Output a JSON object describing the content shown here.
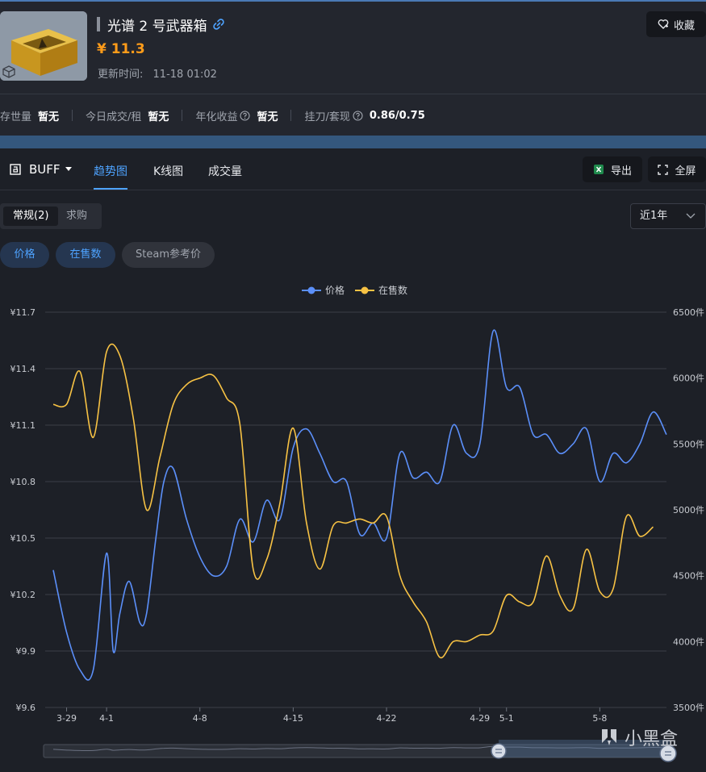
{
  "item": {
    "title": "光谱 2 号武器箱",
    "price": "¥ 11.3",
    "update_label": "更新时间:",
    "update_time": "11-18 01:02",
    "favorite_label": "收藏"
  },
  "stats": [
    {
      "label": "存世量",
      "value": "暂无",
      "help": false
    },
    {
      "label": "今日成交/租",
      "value": "暂无",
      "help": false
    },
    {
      "label": "年化收益",
      "value": "暂无",
      "help": true
    },
    {
      "label": "挂刀/套现",
      "value": "0.86/0.75",
      "help": true
    }
  ],
  "toolbar": {
    "source": "BUFF",
    "tabs": [
      "趋势图",
      "K线图",
      "成交量"
    ],
    "active_tab": 0,
    "export_label": "导出",
    "fullscreen_label": "全屏"
  },
  "filters": {
    "options": [
      "常规(2)",
      "求购"
    ],
    "active": 0,
    "range": "近1年"
  },
  "series_toggles": [
    {
      "label": "价格",
      "on": true
    },
    {
      "label": "在售数",
      "on": true
    },
    {
      "label": "Steam参考价",
      "on": false
    }
  ],
  "watermark": "小黑盒",
  "chart_data": {
    "type": "line",
    "legend_position": "top-center",
    "grid": true,
    "x_ticks": [
      "3-29",
      "4-1",
      "4-8",
      "4-15",
      "4-22",
      "4-29",
      "5-1",
      "5-8"
    ],
    "x_range": [
      "3-28",
      "5-13"
    ],
    "y_left": {
      "ticks": [
        "¥9.6",
        "¥9.9",
        "¥10.2",
        "¥10.5",
        "¥10.8",
        "¥11.1",
        "¥11.4",
        "¥11.7"
      ],
      "range": [
        9.6,
        11.7
      ]
    },
    "y_right": {
      "ticks": [
        "3500件",
        "4000件",
        "4500件",
        "5000件",
        "5500件",
        "6000件",
        "6500件"
      ],
      "range": [
        3500,
        6500
      ]
    },
    "series": [
      {
        "name": "价格",
        "axis": "left",
        "color": "#5b8ff9",
        "points": [
          [
            "3-28",
            10.33
          ],
          [
            "3-29",
            10.0
          ],
          [
            "3-30",
            9.8
          ],
          [
            "3-31",
            9.8
          ],
          [
            "4-1",
            10.42
          ],
          [
            "4-1.5",
            9.9
          ],
          [
            "4-2",
            10.1
          ],
          [
            "4-2.7",
            10.27
          ],
          [
            "4-3.5",
            10.05
          ],
          [
            "4-4",
            10.1
          ],
          [
            "4-4.7",
            10.5
          ],
          [
            "4-5.3",
            10.8
          ],
          [
            "4-6",
            10.87
          ],
          [
            "4-7",
            10.6
          ],
          [
            "4-8",
            10.4
          ],
          [
            "4-9",
            10.3
          ],
          [
            "4-10",
            10.35
          ],
          [
            "4-11",
            10.6
          ],
          [
            "4-12",
            10.48
          ],
          [
            "4-13",
            10.7
          ],
          [
            "4-14",
            10.6
          ],
          [
            "4-15",
            10.98
          ],
          [
            "4-16",
            11.08
          ],
          [
            "4-17",
            10.95
          ],
          [
            "4-18",
            10.8
          ],
          [
            "4-19",
            10.8
          ],
          [
            "4-20",
            10.52
          ],
          [
            "4-21",
            10.58
          ],
          [
            "4-22",
            10.5
          ],
          [
            "4-23",
            10.95
          ],
          [
            "4-24",
            10.82
          ],
          [
            "4-25",
            10.85
          ],
          [
            "4-26",
            10.8
          ],
          [
            "4-27",
            11.1
          ],
          [
            "4-28",
            10.95
          ],
          [
            "4-29",
            11.0
          ],
          [
            "4-30",
            11.6
          ],
          [
            "5-1",
            11.3
          ],
          [
            "5-2",
            11.3
          ],
          [
            "5-3",
            11.05
          ],
          [
            "5-4",
            11.05
          ],
          [
            "5-5",
            10.95
          ],
          [
            "5-6",
            11.0
          ],
          [
            "5-7",
            11.08
          ],
          [
            "5-8",
            10.8
          ],
          [
            "5-9",
            10.95
          ],
          [
            "5-10",
            10.9
          ],
          [
            "5-11",
            11.0
          ],
          [
            "5-12",
            11.17
          ],
          [
            "5-13",
            11.05
          ]
        ]
      },
      {
        "name": "在售数",
        "axis": "right",
        "color": "#f7c244",
        "points": [
          [
            "3-28",
            5800
          ],
          [
            "3-29",
            5800
          ],
          [
            "3-30",
            6050
          ],
          [
            "3-31",
            5550
          ],
          [
            "4-1",
            6200
          ],
          [
            "4-2",
            6170
          ],
          [
            "4-3",
            5700
          ],
          [
            "4-4",
            5000
          ],
          [
            "4-5",
            5400
          ],
          [
            "4-6",
            5800
          ],
          [
            "4-7",
            5950
          ],
          [
            "4-8",
            6000
          ],
          [
            "4-9",
            6020
          ],
          [
            "4-10",
            5850
          ],
          [
            "4-11",
            5650
          ],
          [
            "4-12",
            4550
          ],
          [
            "4-13",
            4620
          ],
          [
            "4-14",
            5050
          ],
          [
            "4-15",
            5620
          ],
          [
            "4-16",
            4900
          ],
          [
            "4-17",
            4550
          ],
          [
            "4-18",
            4880
          ],
          [
            "4-19",
            4900
          ],
          [
            "4-20",
            4930
          ],
          [
            "4-21",
            4900
          ],
          [
            "4-22",
            4950
          ],
          [
            "4-23",
            4500
          ],
          [
            "4-24",
            4300
          ],
          [
            "4-25",
            4150
          ],
          [
            "4-26",
            3880
          ],
          [
            "4-27",
            4000
          ],
          [
            "4-28",
            4000
          ],
          [
            "4-29",
            4050
          ],
          [
            "4-30",
            4080
          ],
          [
            "5-1",
            4350
          ],
          [
            "5-2",
            4300
          ],
          [
            "5-3",
            4300
          ],
          [
            "5-4",
            4650
          ],
          [
            "5-5",
            4350
          ],
          [
            "5-6",
            4250
          ],
          [
            "5-7",
            4700
          ],
          [
            "5-8",
            4380
          ],
          [
            "5-9",
            4400
          ],
          [
            "5-10",
            4950
          ],
          [
            "5-11",
            4800
          ],
          [
            "5-12",
            4870
          ]
        ]
      }
    ]
  }
}
